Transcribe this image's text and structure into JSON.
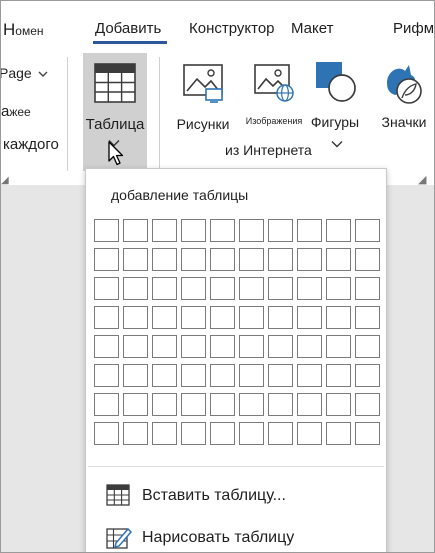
{
  "tabs": {
    "home_big": "Н",
    "home_small": "омен",
    "insert": "Добавить",
    "design": "Конструктор",
    "layout": "Макет",
    "refs": "Рифм"
  },
  "ribbon_left": {
    "page": "Page",
    "je": "жее",
    "each": "каждого"
  },
  "ribbon": {
    "table": "Таблица",
    "pictures": "Рисунки",
    "online_top": "Изображения",
    "online_bottom": "из Интернета",
    "shapes": "Фигуры",
    "icons": "Значки"
  },
  "dropdown": {
    "title": "добавление таблицы",
    "grid_cols": 10,
    "grid_rows": 8,
    "insert_table": "Вставить таблицу...",
    "draw_table": "Нарисовать таблицу"
  },
  "colors": {
    "accent": "#2b579a",
    "selected_bg": "#d0d0d0",
    "doc_bg": "#e6e6e6",
    "icon_blue": "#2e74b5"
  }
}
